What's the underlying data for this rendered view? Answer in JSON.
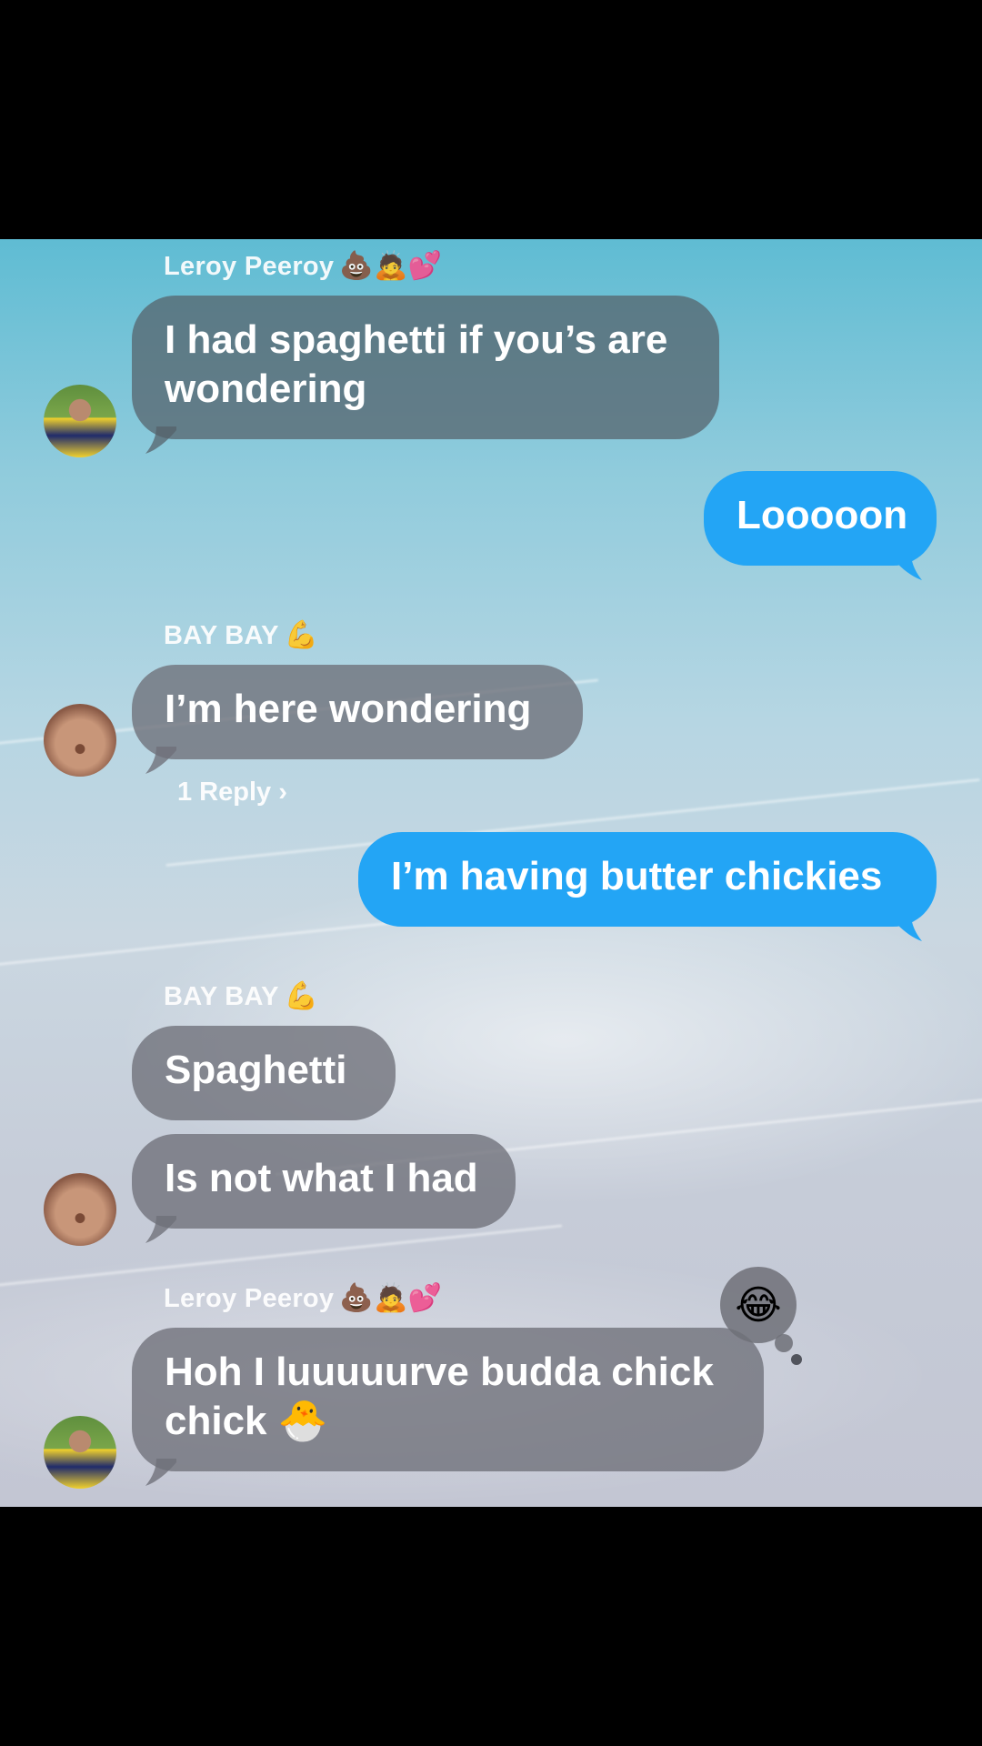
{
  "messages": {
    "m1": {
      "sender": "Leroy Peeroy",
      "sender_emoji": "💩🙇💕",
      "text": "I had spaghetti if you’s are wondering"
    },
    "m2": {
      "text": "Looooon"
    },
    "m3": {
      "sender": "BAY BAY",
      "sender_emoji": "💪",
      "text": "I’m here wondering",
      "reply_label": "1 Reply ›"
    },
    "m4": {
      "text": "I’m having butter chickies"
    },
    "m5": {
      "sender": "BAY BAY",
      "sender_emoji": "💪",
      "text": "Spaghetti"
    },
    "m6": {
      "text": "Is not what I had"
    },
    "m7": {
      "sender": "Leroy Peeroy",
      "sender_emoji": "💩🙇💕",
      "text": "Hoh I luuuuurve budda chick chick 🐣",
      "tapback": "😂"
    }
  },
  "icons": {
    "avatar_leroy": "avatar-photo",
    "avatar_bay": "avatar-photo",
    "tapback": "laughing-face-icon"
  },
  "colors": {
    "outgoing_bubble": "#23a5f5",
    "incoming_bubble": "#5a6068"
  }
}
